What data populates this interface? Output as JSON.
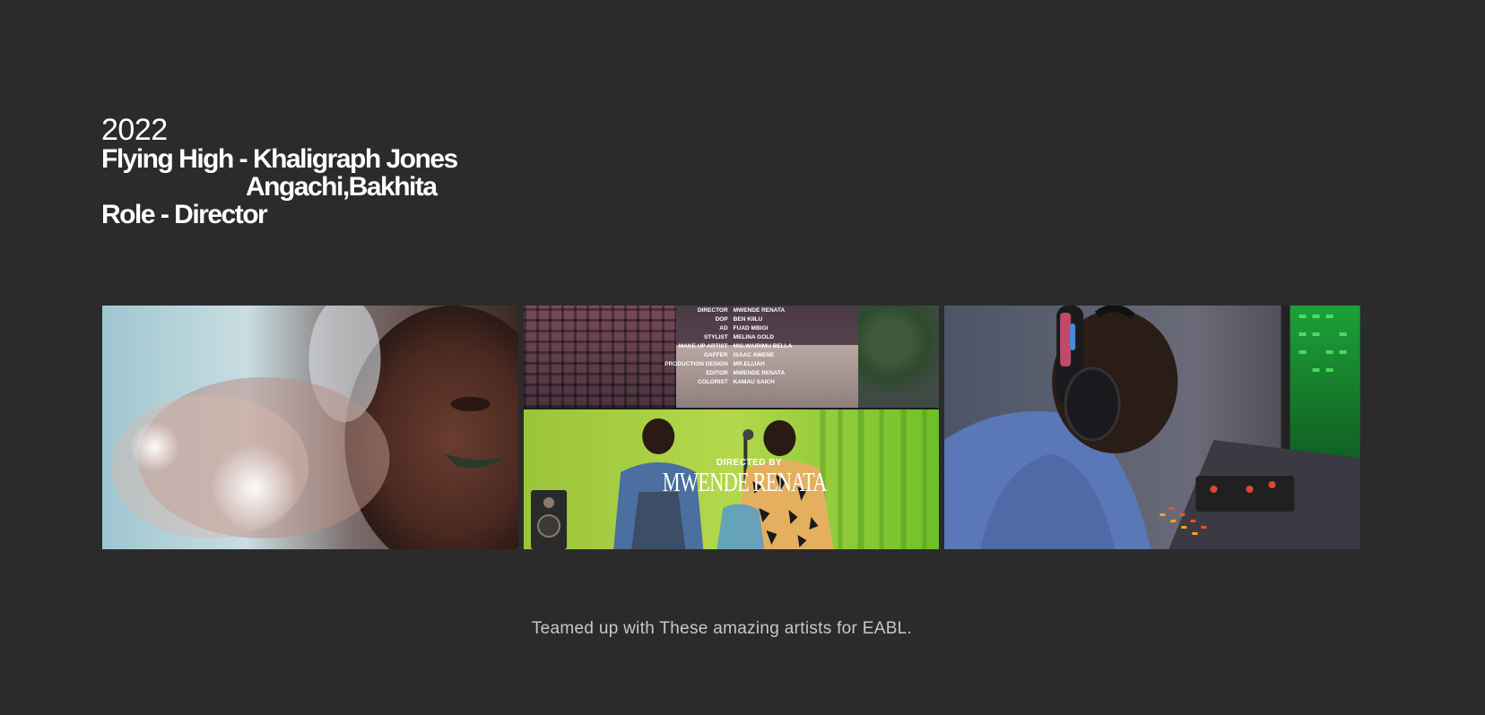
{
  "project": {
    "year": "2022",
    "title_line_1": "Flying High - Khaligraph  Jones",
    "title_line_2": "Angachi,Bakhita",
    "role_line": "Role -  Director"
  },
  "gallery": {
    "credits": [
      {
        "role": "DIRECTOR",
        "name": "MWENDE RENATA"
      },
      {
        "role": "DOP",
        "name": "BEN KIILU"
      },
      {
        "role": "AD",
        "name": "FUAD MBIGI"
      },
      {
        "role": "STYLIST",
        "name": "MELINA GOLD"
      },
      {
        "role": "MAKE UP ARTIST",
        "name": "MIS.WAIRIMU BELLA"
      },
      {
        "role": "GAFFER",
        "name": "ISAAC AWENE"
      },
      {
        "role": "PRODUCTION DESIGN",
        "name": "MR.ELIJAH"
      },
      {
        "role": "EDITOR",
        "name": "MWENDE RENATA"
      },
      {
        "role": "COLORIST",
        "name": "KAMAU SAICH"
      }
    ],
    "directed_by_label": "DIRECTED BY",
    "directed_by_name": "MWENDE RENATA"
  },
  "caption": "Teamed up with These amazing artists for EABL."
}
